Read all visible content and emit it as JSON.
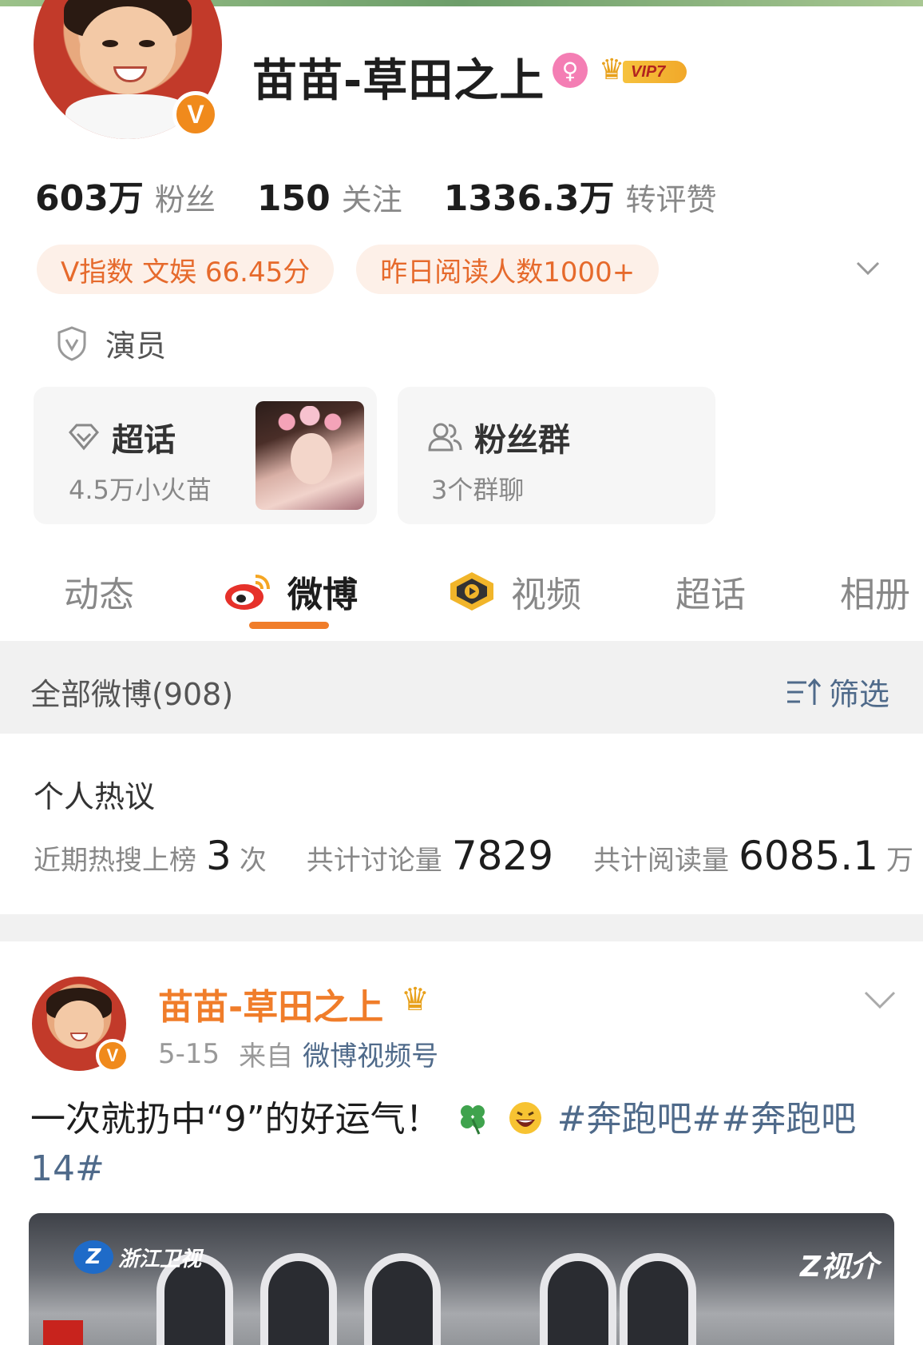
{
  "profile": {
    "name": "苗苗-草田之上",
    "vip_label": "VIP7",
    "verified_mark": "V"
  },
  "stats": [
    {
      "value": "603万",
      "label": "粉丝"
    },
    {
      "value": "150",
      "label": "关注"
    },
    {
      "value": "1336.3万",
      "label": "转评赞"
    }
  ],
  "pills": [
    {
      "text": "V指数 文娱 66.45分"
    },
    {
      "text": "昨日阅读人数1000+"
    }
  ],
  "occupation": "演员",
  "cards": {
    "super_topic": {
      "title": "超话",
      "sub": "4.5万小火苗"
    },
    "fan_group": {
      "title": "粉丝群",
      "sub": "3个群聊"
    }
  },
  "tabs": [
    {
      "label": "动态"
    },
    {
      "label": "微博"
    },
    {
      "label": "视频"
    },
    {
      "label": "超话"
    },
    {
      "label": "相册"
    }
  ],
  "active_tab": "微博",
  "filter_bar": {
    "count_label": "全部微博(908)",
    "filter_label": "筛选"
  },
  "hot": {
    "title": "个人热议",
    "items": [
      {
        "label": "近期热搜上榜",
        "value": "3",
        "unit": "次"
      },
      {
        "label": "共计讨论量",
        "value": "7829",
        "unit": ""
      },
      {
        "label": "共计阅读量",
        "value": "6085.1",
        "unit": "万"
      }
    ]
  },
  "post": {
    "author": "苗苗-草田之上",
    "date": "5-15",
    "from_label": "来自",
    "source": "微博视频号",
    "text": "一次就扔中“9”的好运气！",
    "tags": "#奔跑吧##奔跑吧14#",
    "media": {
      "logo_left": "浙江卫视",
      "logo_right": "Z视介"
    }
  },
  "colors": {
    "accent": "#f07d2a",
    "link": "#4f6a8a",
    "pill_bg": "#fdf0e8",
    "pill_text": "#e66a2c",
    "verified": "#f08a1c"
  },
  "icons": [
    "vip-crown-icon",
    "female-icon",
    "chevron-down-icon",
    "shield-v-icon",
    "diamond-icon",
    "people-icon",
    "weibo-logo-icon",
    "video-play-icon",
    "filter-icon",
    "clover-emoji",
    "laugh-emoji"
  ]
}
